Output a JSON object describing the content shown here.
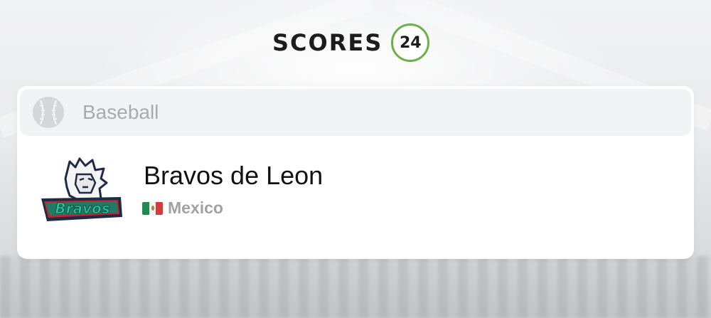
{
  "brand": {
    "name": "SCORES",
    "badge": "24",
    "accent": "#6ab04c"
  },
  "card": {
    "sport": {
      "label": "Baseball",
      "icon": "baseball-icon"
    },
    "team": {
      "name": "Bravos de Leon",
      "logo_text": "Bravos",
      "logo_icon": "lion-logo-icon",
      "country": "Mexico",
      "flag_icon": "mexico-flag-icon"
    }
  }
}
